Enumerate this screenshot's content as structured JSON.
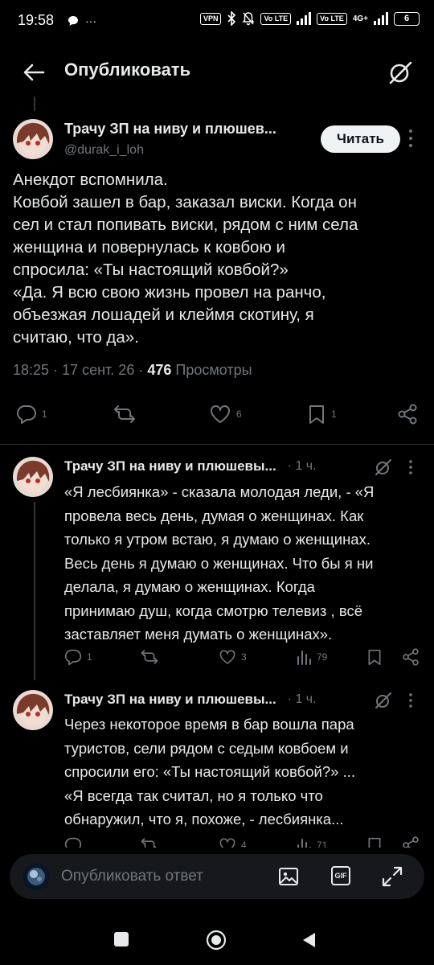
{
  "status_bar": {
    "time": "19:58",
    "left_extra": "···",
    "vpn": "VPN",
    "lte1": "Vo LTE",
    "lte2": "Vo LTE",
    "net": "4G+",
    "battery": "6"
  },
  "topbar": {
    "title": "Опубликовать"
  },
  "main_post": {
    "author": "Трачу ЗП на ниву и плюшев...",
    "handle": "@durak_i_loh",
    "follow_label": "Читать",
    "text_lines": [
      "Анекдот вспомнила.",
      "Ковбой зашел в бар, заказал виски. Когда он",
      "сел и стал попивать виски, рядом с ним села",
      "женщина и повернулась к ковбою и",
      "спросила: «Ты настоящий ковбой?»",
      "«Да. Я всю свою жизнь провел на ранчо,",
      "объезжая лошадей и клеймя скотину, я",
      "считаю, что да»."
    ],
    "time": "18:25",
    "date": "17 сент. 26",
    "views_count": "476",
    "views_label": "Просмотры",
    "stats": {
      "replies": "1",
      "likes": "6",
      "bookmarks": "1"
    }
  },
  "replies": [
    {
      "author": "Трачу ЗП на ниву и плюшевы...",
      "time": "· 1 ч.",
      "text_lines": [
        "«Я лесбиянка» - сказала молодая леди, - «Я",
        "провела весь день, думая о женщинах. Как",
        "только я утром встаю, я думаю о женщинах.",
        "Весь день я думаю о женщинах. Что бы я ни",
        "делала, я думаю о женщинах. Когда",
        "принимаю душ, когда смотрю телевиз , всё",
        "заставляет меня думать о женщинах»."
      ],
      "stats": {
        "replies": "1",
        "reposts": "",
        "likes": "3",
        "views": "79"
      }
    },
    {
      "author": "Трачу ЗП на ниву и плюшевы...",
      "time": "· 1 ч.",
      "text_lines": [
        "Через некоторое время в бар вошла пара",
        "туристов, сели рядом с седым ковбоем и",
        "спросили его: «Ты настоящий ковбой?» ...",
        "«Я всегда так считал, но я только что",
        "обнаружил, что я, похоже, - лесбиянка..."
      ],
      "stats": {
        "likes": "4",
        "views": "71"
      }
    }
  ],
  "composer": {
    "placeholder": "Опубликовать ответ",
    "gif_label": "GIF"
  }
}
